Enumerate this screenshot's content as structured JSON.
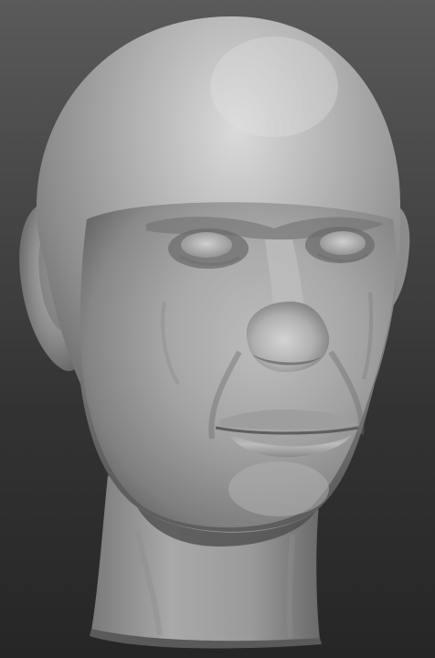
{
  "viewport": {
    "background_top": "#5a5a5a",
    "background_bottom": "#262626"
  },
  "model": {
    "subject": "sculpted-head-bust",
    "material_base": "#9a9a9a",
    "material_highlight": "#d6d6d6",
    "material_shadow": "#4a4a4a"
  }
}
